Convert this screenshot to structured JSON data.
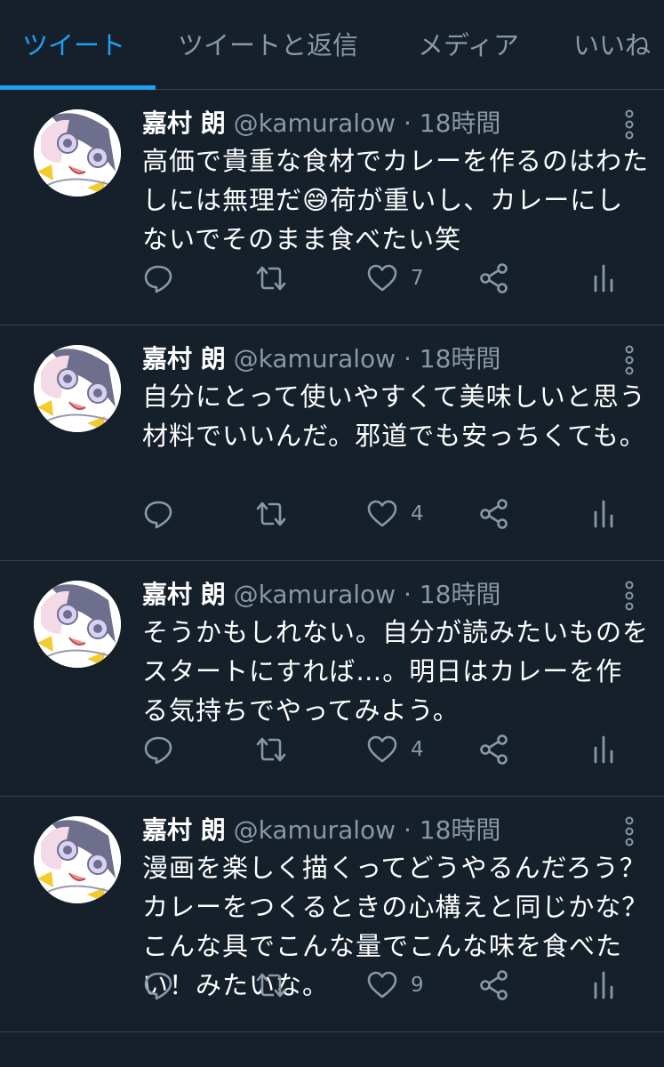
{
  "tabs": [
    {
      "label": "ツイート",
      "active": true
    },
    {
      "label": "ツイートと返信",
      "active": false
    },
    {
      "label": "メディア",
      "active": false
    },
    {
      "label": "いいね",
      "active": false
    }
  ],
  "colors": {
    "background": "#15202b",
    "accent": "#1da1f2",
    "muted": "#8899a6",
    "divider": "#38444d"
  },
  "icons": [
    "reply-icon",
    "retweet-icon",
    "like-icon",
    "share-icon",
    "analytics-icon",
    "more-vertical-icon"
  ],
  "tweets": [
    {
      "name": "嘉村 朗",
      "handle": "@kamuralow",
      "separator": "·",
      "time": "18時間",
      "text": "高価で貴重な食材でカレーを作るのはわたしには無理だ😅荷が重いし、カレーにしないでそのまま食べたい笑",
      "likes": "7"
    },
    {
      "name": "嘉村 朗",
      "handle": "@kamuralow",
      "separator": "·",
      "time": "18時間",
      "text": "自分にとって使いやすくて美味しいと思う材料でいいんだ。邪道でも安っちくても。",
      "likes": "4"
    },
    {
      "name": "嘉村 朗",
      "handle": "@kamuralow",
      "separator": "·",
      "time": "18時間",
      "text": "そうかもしれない。自分が読みたいものをスタートにすれば…。明日はカレーを作る気持ちでやってみよう。",
      "likes": "4"
    },
    {
      "name": "嘉村 朗",
      "handle": "@kamuralow",
      "separator": "·",
      "time": "18時間",
      "text": "漫画を楽しく描くってどうやるんだろう？カレーをつくるときの心構えと同じかな？こんな具でこんな量でこんな味を食べたい！みたいな。",
      "likes": "9"
    }
  ]
}
